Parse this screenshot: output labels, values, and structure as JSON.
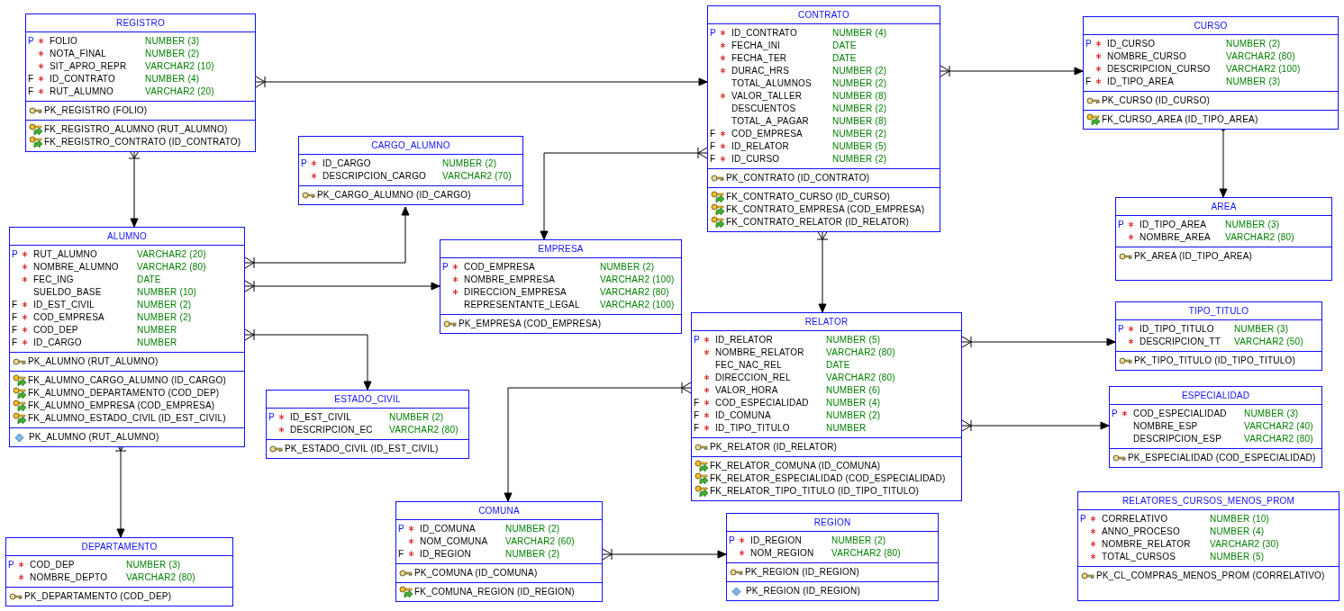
{
  "tables": [
    {
      "name": "REGISTRO",
      "columns": [
        {
          "flag": "P",
          "required": true,
          "name": "FOLIO",
          "type": "NUMBER (3)"
        },
        {
          "required": true,
          "name": "NOTA_FINAL",
          "type": "NUMBER (2)"
        },
        {
          "required": true,
          "name": "SIT_APRO_REPR",
          "type": "VARCHAR2 (10)"
        },
        {
          "flag": "F",
          "required": true,
          "name": "ID_CONTRATO",
          "type": "NUMBER (4)"
        },
        {
          "flag": "F",
          "required": true,
          "name": "RUT_ALUMNO",
          "type": "VARCHAR2 (20)"
        }
      ],
      "primary_keys": [
        "PK_REGISTRO (FOLIO)"
      ],
      "foreign_keys": [
        "FK_REGISTRO_ALUMNO (RUT_ALUMNO)",
        "FK_REGISTRO_CONTRATO (ID_CONTRATO)"
      ]
    },
    {
      "name": "CARGO_ALUMNO",
      "columns": [
        {
          "flag": "P",
          "required": true,
          "name": "ID_CARGO",
          "type": "NUMBER (2)"
        },
        {
          "required": true,
          "name": "DESCRIPCION_CARGO",
          "type": "VARCHAR2 (70)"
        }
      ],
      "primary_keys": [
        "PK_CARGO_ALUMNO (ID_CARGO)"
      ]
    },
    {
      "name": "ALUMNO",
      "columns": [
        {
          "flag": "P",
          "required": true,
          "name": "RUT_ALUMNO",
          "type": "VARCHAR2 (20)"
        },
        {
          "required": true,
          "name": "NOMBRE_ALUMNO",
          "type": "VARCHAR2 (80)"
        },
        {
          "required": true,
          "name": "FEC_ING",
          "type": "DATE"
        },
        {
          "required": false,
          "name": "SUELDO_BASE",
          "type": "NUMBER (10)"
        },
        {
          "flag": "F",
          "required": true,
          "name": "ID_EST_CIVIL",
          "type": "NUMBER (2)"
        },
        {
          "flag": "F",
          "required": true,
          "name": "COD_EMPRESA",
          "type": "NUMBER (2)"
        },
        {
          "flag": "F",
          "required": true,
          "name": "COD_DEP",
          "type": "NUMBER"
        },
        {
          "flag": "F",
          "required": true,
          "name": "ID_CARGO",
          "type": "NUMBER"
        }
      ],
      "primary_keys": [
        "PK_ALUMNO (RUT_ALUMNO)"
      ],
      "foreign_keys": [
        "FK_ALUMNO_CARGO_ALUMNO (ID_CARGO)",
        "FK_ALUMNO_DEPARTAMENTO (COD_DEP)",
        "FK_ALUMNO_EMPRESA (COD_EMPRESA)",
        "FK_ALUMNO_ESTADO_CIVIL (ID_EST_CIVIL)"
      ],
      "indexes": [
        "PK_ALUMNO (RUT_ALUMNO)"
      ]
    },
    {
      "name": "EMPRESA",
      "columns": [
        {
          "flag": "P",
          "required": true,
          "name": "COD_EMPRESA",
          "type": "NUMBER (2)"
        },
        {
          "required": true,
          "name": "NOMBRE_EMPRESA",
          "type": "VARCHAR2 (100)"
        },
        {
          "required": true,
          "name": "DIRECCION_EMPRESA",
          "type": "VARCHAR2 (80)"
        },
        {
          "required": false,
          "name": "REPRESENTANTE_LEGAL",
          "type": "VARCHAR2 (100)"
        }
      ],
      "primary_keys": [
        "PK_EMPRESA (COD_EMPRESA)"
      ]
    },
    {
      "name": "ESTADO_CIVIL",
      "columns": [
        {
          "flag": "P",
          "required": true,
          "name": "ID_EST_CIVIL",
          "type": "NUMBER (2)"
        },
        {
          "required": true,
          "name": "DESCRIPCION_EC",
          "type": "VARCHAR2 (80)"
        }
      ],
      "primary_keys": [
        "PK_ESTADO_CIVIL (ID_EST_CIVIL)"
      ]
    },
    {
      "name": "DEPARTAMENTO",
      "columns": [
        {
          "flag": "P",
          "required": true,
          "name": "COD_DEP",
          "type": "NUMBER (3)"
        },
        {
          "required": true,
          "name": "NOMBRE_DEPTO",
          "type": "VARCHAR2 (80)"
        }
      ],
      "primary_keys": [
        "PK_DEPARTAMENTO (COD_DEP)"
      ]
    },
    {
      "name": "CONTRATO",
      "columns": [
        {
          "flag": "P",
          "required": true,
          "name": "ID_CONTRATO",
          "type": "NUMBER (4)"
        },
        {
          "required": true,
          "name": "FECHA_INI",
          "type": "DATE"
        },
        {
          "required": true,
          "name": "FECHA_TER",
          "type": "DATE"
        },
        {
          "required": true,
          "name": "DURAC_HRS",
          "type": "NUMBER (2)"
        },
        {
          "required": false,
          "name": "TOTAL_ALUMNOS",
          "type": "NUMBER (2)"
        },
        {
          "required": true,
          "name": "VALOR_TALLER",
          "type": "NUMBER (8)"
        },
        {
          "required": false,
          "name": "DESCUENTOS",
          "type": "NUMBER (2)"
        },
        {
          "required": false,
          "name": "TOTAL_A_PAGAR",
          "type": "NUMBER (8)"
        },
        {
          "flag": "F",
          "required": true,
          "name": "COD_EMPRESA",
          "type": "NUMBER (2)"
        },
        {
          "flag": "F",
          "required": true,
          "name": "ID_RELATOR",
          "type": "NUMBER (5)"
        },
        {
          "flag": "F",
          "required": true,
          "name": "ID_CURSO",
          "type": "NUMBER (2)"
        }
      ],
      "primary_keys": [
        "PK_CONTRATO (ID_CONTRATO)"
      ],
      "foreign_keys": [
        "FK_CONTRATO_CURSO (ID_CURSO)",
        "FK_CONTRATO_EMPRESA (COD_EMPRESA)",
        "FK_CONTRATO_RELATOR (ID_RELATOR)"
      ]
    },
    {
      "name": "CURSO",
      "columns": [
        {
          "flag": "P",
          "required": true,
          "name": "ID_CURSO",
          "type": "NUMBER (2)"
        },
        {
          "required": true,
          "name": "NOMBRE_CURSO",
          "type": "VARCHAR2 (80)"
        },
        {
          "required": true,
          "name": "DESCRIPCION_CURSO",
          "type": "VARCHAR2 (100)"
        },
        {
          "flag": "F",
          "required": true,
          "name": "ID_TIPO_AREA",
          "type": "NUMBER (3)"
        }
      ],
      "primary_keys": [
        "PK_CURSO (ID_CURSO)"
      ],
      "foreign_keys": [
        "FK_CURSO_AREA (ID_TIPO_AREA)"
      ]
    },
    {
      "name": "AREA",
      "columns": [
        {
          "flag": "P",
          "required": true,
          "name": "ID_TIPO_AREA",
          "type": "NUMBER (3)"
        },
        {
          "required": true,
          "name": "NOMBRE_AREA",
          "type": "VARCHAR2 (80)"
        }
      ],
      "primary_keys": [
        "PK_AREA (ID_TIPO_AREA)"
      ]
    },
    {
      "name": "RELATOR",
      "columns": [
        {
          "flag": "P",
          "required": true,
          "name": "ID_RELATOR",
          "type": "NUMBER (5)"
        },
        {
          "required": true,
          "name": "NOMBRE_RELATOR",
          "type": "VARCHAR2 (80)"
        },
        {
          "required": false,
          "name": "FEC_NAC_REL",
          "type": "DATE"
        },
        {
          "required": true,
          "name": "DIRECCION_REL",
          "type": "VARCHAR2 (80)"
        },
        {
          "required": true,
          "name": "VALOR_HORA",
          "type": "NUMBER (6)"
        },
        {
          "flag": "F",
          "required": true,
          "name": "COD_ESPECIALIDAD",
          "type": "NUMBER (4)"
        },
        {
          "flag": "F",
          "required": true,
          "name": "ID_COMUNA",
          "type": "NUMBER (2)"
        },
        {
          "flag": "F",
          "required": true,
          "name": "ID_TIPO_TITULO",
          "type": "NUMBER"
        }
      ],
      "primary_keys": [
        "PK_RELATOR (ID_RELATOR)"
      ],
      "foreign_keys": [
        "FK_RELATOR_COMUNA (ID_COMUNA)",
        "FK_RELATOR_ESPECIALIDAD (COD_ESPECIALIDAD)",
        "FK_RELATOR_TIPO_TITULO (ID_TIPO_TITULO)"
      ]
    },
    {
      "name": "TIPO_TITULO",
      "columns": [
        {
          "flag": "P",
          "required": true,
          "name": "ID_TIPO_TITULO",
          "type": "NUMBER (3)"
        },
        {
          "required": true,
          "name": "DESCRIPCION_TT",
          "type": "VARCHAR2 (50)"
        }
      ],
      "primary_keys": [
        "PK_TIPO_TITULO (ID_TIPO_TITULO)"
      ]
    },
    {
      "name": "ESPECIALIDAD",
      "columns": [
        {
          "flag": "P",
          "required": true,
          "name": "COD_ESPECIALIDAD",
          "type": "NUMBER (3)"
        },
        {
          "required": false,
          "name": "NOMBRE_ESP",
          "type": "VARCHAR2 (40)"
        },
        {
          "required": false,
          "name": "DESCRIPCION_ESP",
          "type": "VARCHAR2 (80)"
        }
      ],
      "primary_keys": [
        "PK_ESPECIALIDAD (COD_ESPECIALIDAD)"
      ]
    },
    {
      "name": "COMUNA",
      "columns": [
        {
          "flag": "P",
          "required": true,
          "name": "ID_COMUNA",
          "type": "NUMBER (2)"
        },
        {
          "required": true,
          "name": "NOM_COMUNA",
          "type": "VARCHAR2 (60)"
        },
        {
          "flag": "F",
          "required": true,
          "name": "ID_REGION",
          "type": "NUMBER (2)"
        }
      ],
      "primary_keys": [
        "PK_COMUNA (ID_COMUNA)"
      ],
      "foreign_keys": [
        "FK_COMUNA_REGION (ID_REGION)"
      ]
    },
    {
      "name": "REGION",
      "columns": [
        {
          "flag": "P",
          "required": true,
          "name": "ID_REGION",
          "type": "NUMBER (2)"
        },
        {
          "required": true,
          "name": "NOM_REGION",
          "type": "VARCHAR2 (80)"
        }
      ],
      "primary_keys": [
        "PK_REGION (ID_REGION)"
      ],
      "indexes": [
        "PK_REGION (ID_REGION)"
      ]
    },
    {
      "name": "RELATORES_CURSOS_MENOS_PROM",
      "columns": [
        {
          "flag": "P",
          "required": true,
          "name": "CORRELATIVO",
          "type": "NUMBER (10)"
        },
        {
          "required": true,
          "name": "ANNO_PROCESO",
          "type": "NUMBER (4)"
        },
        {
          "required": true,
          "name": "NOMBRE_RELATOR",
          "type": "VARCHAR2 (30)"
        },
        {
          "required": true,
          "name": "TOTAL_CURSOS",
          "type": "NUMBER (5)"
        }
      ],
      "primary_keys": [
        "PK_CL_COMPRAS_MENOS_PROM (CORRELATIVO)"
      ]
    }
  ]
}
